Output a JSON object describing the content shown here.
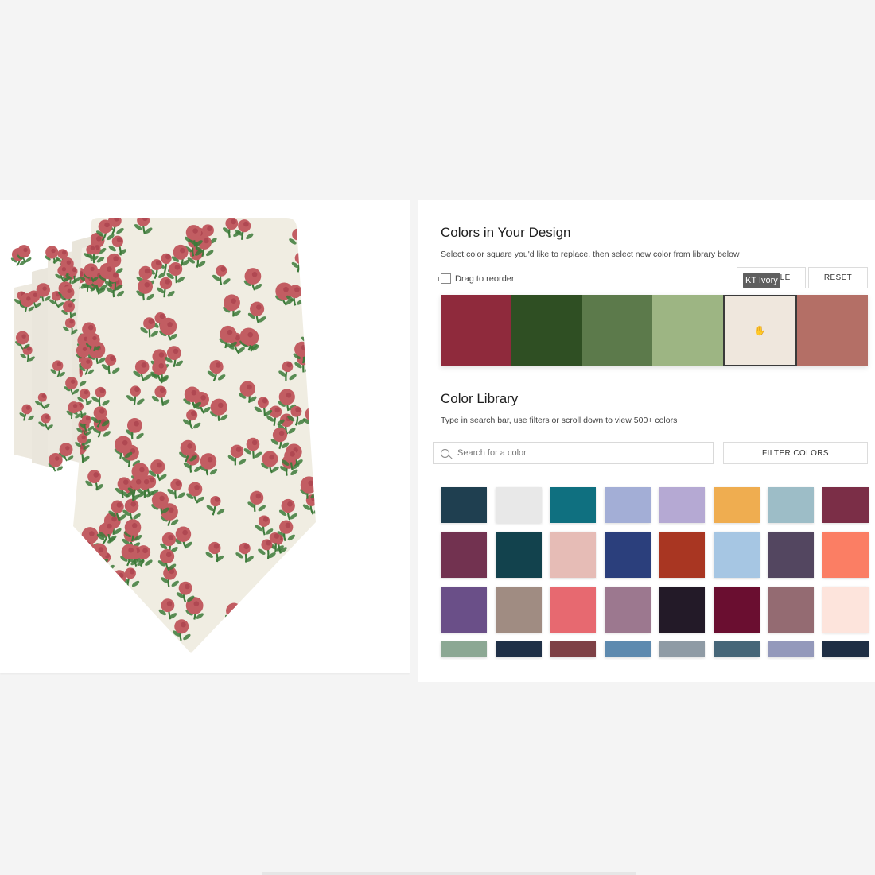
{
  "design": {
    "title": "Colors in Your Design",
    "subtitle": "Select color square you'd like to replace, then select new color from library below",
    "drag_hint": "Drag to reorder",
    "shuffle_label": "SHUFFLE",
    "reset_label": "RESET",
    "tooltip": "KT Ivory",
    "colors": [
      {
        "hex": "#8f2a3c"
      },
      {
        "hex": "#2f4f23"
      },
      {
        "hex": "#5c7a4b"
      },
      {
        "hex": "#9db583"
      },
      {
        "hex": "#efe7dd",
        "selected": true
      },
      {
        "hex": "#b46f66"
      }
    ]
  },
  "library": {
    "title": "Color Library",
    "subtitle": "Type in search bar, use filters or scroll down to view 500+ colors",
    "search_placeholder": "Search for a color",
    "filter_label": "FILTER COLORS",
    "rows": [
      [
        "#1f3f50",
        "#e8e8e8",
        "#0f7080",
        "#a3aed6",
        "#b5a9d3",
        "#efad50",
        "#9dbdc7",
        "#7b2e47"
      ],
      [
        "#723250",
        "#12424d",
        "#e6bcb6",
        "#2b3f7c",
        "#a93622",
        "#a6c6e3",
        "#534660",
        "#fb7e64"
      ],
      [
        "#6a4f88",
        "#a08c82",
        "#e76970",
        "#9c788f",
        "#231a28",
        "#6a0e30",
        "#946b72",
        "#fde4dc"
      ],
      [
        "#8ca894",
        "#1f3047",
        "#7e4146",
        "#5e8aaf",
        "#8f9ba5",
        "#466678",
        "#9499bb",
        "#1e2e44"
      ]
    ]
  },
  "tie": {
    "base_color": "#f0ede2",
    "flower_color": "#c25d62",
    "leaf_color": "#3d7a3a"
  }
}
